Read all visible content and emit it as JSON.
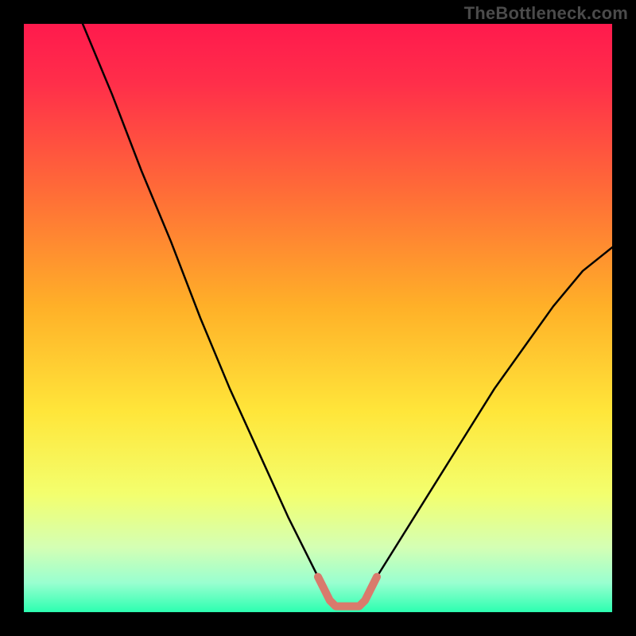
{
  "attribution": "TheBottleneck.com",
  "colors": {
    "frame": "#000000",
    "curve": "#000000",
    "highlight": "#d97a6c",
    "gradient_stops": [
      {
        "offset": 0.0,
        "color": "#ff1a4d"
      },
      {
        "offset": 0.1,
        "color": "#ff2e4a"
      },
      {
        "offset": 0.28,
        "color": "#ff6a38"
      },
      {
        "offset": 0.48,
        "color": "#ffb028"
      },
      {
        "offset": 0.66,
        "color": "#ffe63a"
      },
      {
        "offset": 0.8,
        "color": "#f3ff6e"
      },
      {
        "offset": 0.89,
        "color": "#d4ffb4"
      },
      {
        "offset": 0.95,
        "color": "#99ffd0"
      },
      {
        "offset": 1.0,
        "color": "#2cffb0"
      }
    ]
  },
  "chart_data": {
    "type": "line",
    "title": "",
    "xlabel": "",
    "ylabel": "",
    "xlim": [
      0,
      100
    ],
    "ylim": [
      0,
      100
    ],
    "grid": false,
    "legend": false,
    "series": [
      {
        "name": "bottleneck-curve",
        "x": [
          10,
          15,
          20,
          25,
          30,
          35,
          40,
          45,
          50,
          51,
          52,
          53,
          54,
          55,
          56,
          57,
          58,
          59,
          60,
          65,
          70,
          75,
          80,
          85,
          90,
          95,
          100
        ],
        "y": [
          100,
          88,
          75,
          63,
          50,
          38,
          27,
          16,
          6,
          4,
          2,
          1,
          1,
          1,
          1,
          1,
          2,
          4,
          6,
          14,
          22,
          30,
          38,
          45,
          52,
          58,
          62
        ]
      }
    ],
    "highlight_range_x": [
      50,
      60
    ],
    "annotations": []
  }
}
